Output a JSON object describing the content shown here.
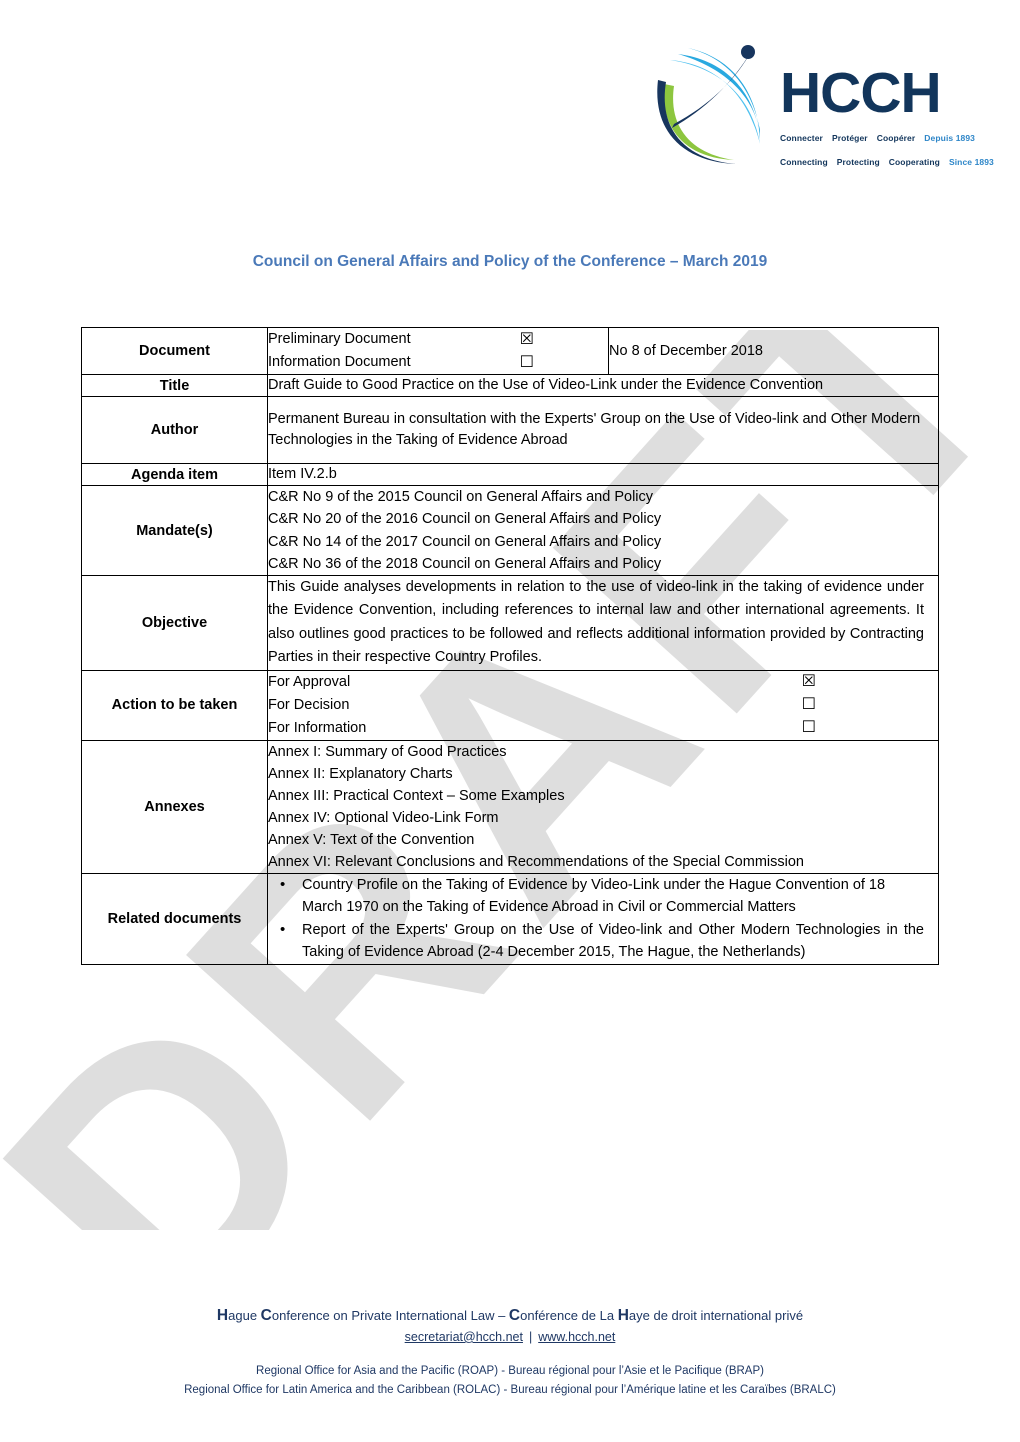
{
  "logo": {
    "wordmark": "HCCH",
    "tagline_fr": [
      "Connecter",
      "Protéger",
      "Coopérer"
    ],
    "tagline_en": [
      "Connecting",
      "Protecting",
      "Cooperating"
    ],
    "since_fr": "Depuis 1893",
    "since_en": "Since 1893",
    "colors": {
      "navy": "#12355B",
      "green": "#8DC63F",
      "light_blue": "#29A9E0",
      "mid_blue": "#2E86C8"
    }
  },
  "watermark": "DRAFT",
  "doc_title": "Council on General Affairs and Policy of the Conference – March 2019",
  "title_color": "#4A79B8",
  "table": {
    "document": {
      "label": "Document",
      "options": [
        {
          "text": "Preliminary Document",
          "checkbox": "☒",
          "checked": true
        },
        {
          "text": "Information Document",
          "checkbox": "☐",
          "checked": false
        }
      ],
      "number": "No 8 of December 2018"
    },
    "title": {
      "label": "Title",
      "value": "Draft Guide to Good Practice on the Use of Video-Link under the Evidence Convention"
    },
    "author": {
      "label": "Author",
      "value": "Permanent Bureau in consultation with the Experts' Group on the Use of Video-link and Other Modern Technologies in the Taking of Evidence Abroad"
    },
    "agenda_item": {
      "label": "Agenda item",
      "value": "Item IV.2.b"
    },
    "mandates": {
      "label": "Mandate(s)",
      "items": [
        "C&R No 9 of the 2015 Council on General Affairs and Policy",
        "C&R No 20 of the 2016 Council on General Affairs and Policy",
        "C&R No 14 of the 2017 Council on General Affairs and Policy",
        "C&R No 36 of the 2018 Council on General Affairs and Policy"
      ]
    },
    "objective": {
      "label": "Objective",
      "value": "This Guide analyses developments in relation to the use of video-link in the taking of evidence under the Evidence Convention, including references to internal law and other international agreements. It also outlines good practices to be followed and reflects additional information provided by Contracting Parties in their respective Country Profiles."
    },
    "action": {
      "label": "Action to be taken",
      "options": [
        {
          "text": "For Approval",
          "checkbox": "☒",
          "checked": true
        },
        {
          "text": "For Decision",
          "checkbox": "☐",
          "checked": false
        },
        {
          "text": "For Information",
          "checkbox": "☐",
          "checked": false
        }
      ]
    },
    "annexes": {
      "label": "Annexes",
      "items": [
        "Annex I: Summary of Good Practices",
        "Annex II: Explanatory Charts",
        "Annex III: Practical Context – Some Examples",
        "Annex IV: Optional Video-Link Form",
        "Annex V: Text of the Convention",
        "Annex VI: Relevant Conclusions and Recommendations of the Special Commission"
      ]
    },
    "related_documents": {
      "label": "Related documents",
      "items": [
        "Country Profile on the Taking of Evidence by Video-Link under the Hague Convention of 18 March 1970 on the Taking of Evidence Abroad in Civil or Commercial Matters",
        "Report of the Experts' Group on the Use of Video-link and Other Modern Technologies in the Taking of Evidence Abroad (2-4 December 2015, The Hague, the Netherlands)"
      ]
    }
  },
  "footer": {
    "org_line_pre": "ague ",
    "org_line": {
      "c1": "H",
      "t1": "ague ",
      "c2": "C",
      "t2": "onference on Private International Law – ",
      "c3": "C",
      "t3": "onférence de La ",
      "c4": "H",
      "t4": "aye de droit international privé"
    },
    "email": "secretariat@hcch.net",
    "separator": "|",
    "website": "www.hcch.net",
    "regional_1": "Regional Office for Asia and the Pacific (ROAP) - Bureau régional pour l’Asie et le Pacifique (BRAP)",
    "regional_2": "Regional Office for Latin America and the Caribbean (ROLAC) - Bureau régional pour l’Amérique latine et les Caraïbes (BRALC)",
    "color": "#1F3864"
  }
}
